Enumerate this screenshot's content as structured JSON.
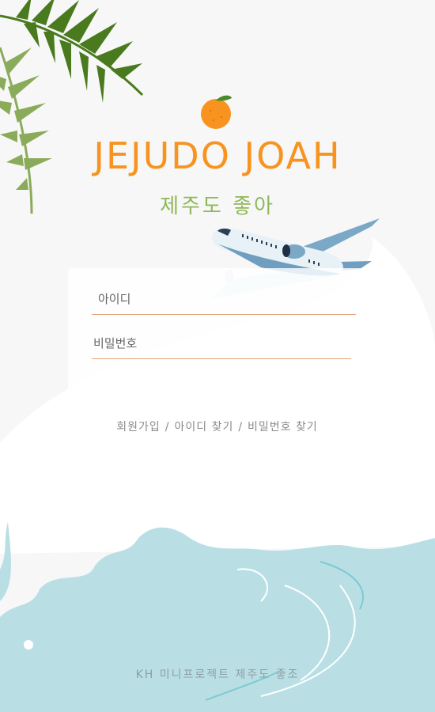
{
  "brand": {
    "title": "JEJUDO JOAH",
    "subtitle": "제주도 좋아"
  },
  "login": {
    "id_placeholder": "아이디",
    "password_placeholder": "비밀번호"
  },
  "links": {
    "signup": "회원가입",
    "separator": "/",
    "find_id": "아이디 찾기",
    "find_password": "비밀번호 찾기"
  },
  "footer": {
    "text": "KH 미니프로젝트 제주도 좋조"
  },
  "colors": {
    "brand_orange": "#f7931e",
    "subtitle_green": "#8fb85a",
    "sea_blue": "#b9dfe5",
    "palm_green": "#4a7a1e"
  },
  "icons": {
    "tangerine": "tangerine-icon",
    "airplane": "airplane-illustration",
    "palm": "palm-leaves-illustration",
    "wave": "wave-illustration"
  }
}
